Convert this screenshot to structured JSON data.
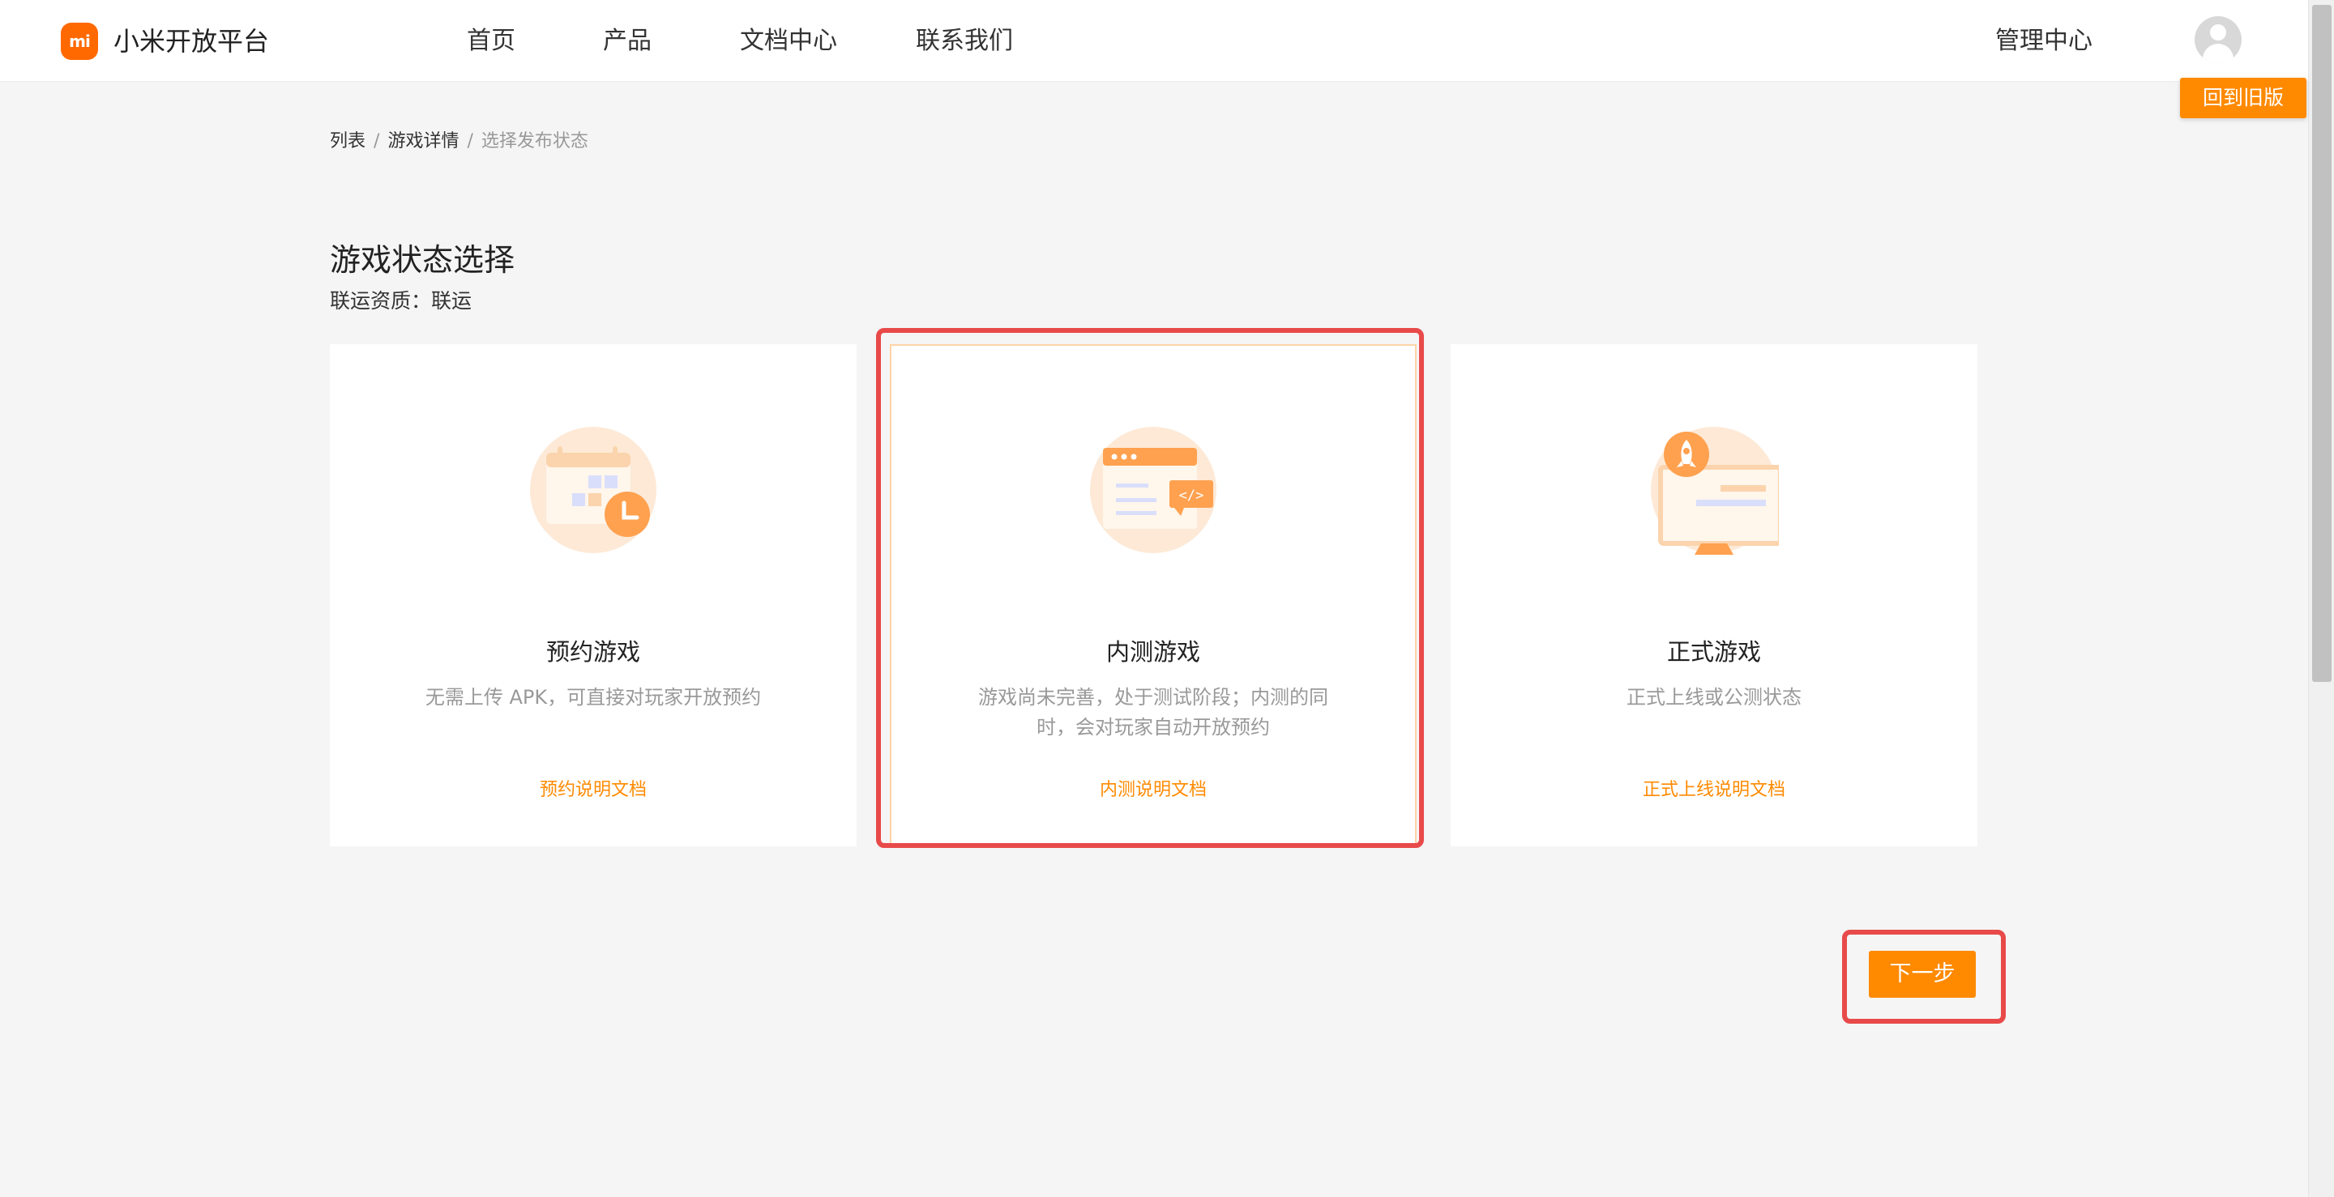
{
  "header": {
    "logo_text": "mi",
    "brand": "小米开放平台",
    "nav": [
      "首页",
      "产品",
      "文档中心",
      "联系我们"
    ],
    "admin": "管理中心"
  },
  "old_version_label": "回到旧版",
  "breadcrumb": {
    "items": [
      "列表",
      "游戏详情",
      "选择发布状态"
    ],
    "separator": "/"
  },
  "page_title": "游戏状态选择",
  "qualification": "联运资质：联运",
  "cards": [
    {
      "title": "预约游戏",
      "desc": "无需上传 APK，可直接对玩家开放预约",
      "link": "预约说明文档",
      "icon": "calendar-clock-icon"
    },
    {
      "title": "内测游戏",
      "desc": "游戏尚未完善，处于测试阶段；内测的同时，会对玩家自动开放预约",
      "link": "内测说明文档",
      "icon": "browser-code-icon",
      "selected": true
    },
    {
      "title": "正式游戏",
      "desc": "正式上线或公测状态",
      "link": "正式上线说明文档",
      "icon": "monitor-rocket-icon"
    }
  ],
  "next_label": "下一步",
  "colors": {
    "accent": "#ff8a00",
    "brand": "#ff6900",
    "highlight": "#e84a4a",
    "icon_bg": "#fde9d6"
  }
}
